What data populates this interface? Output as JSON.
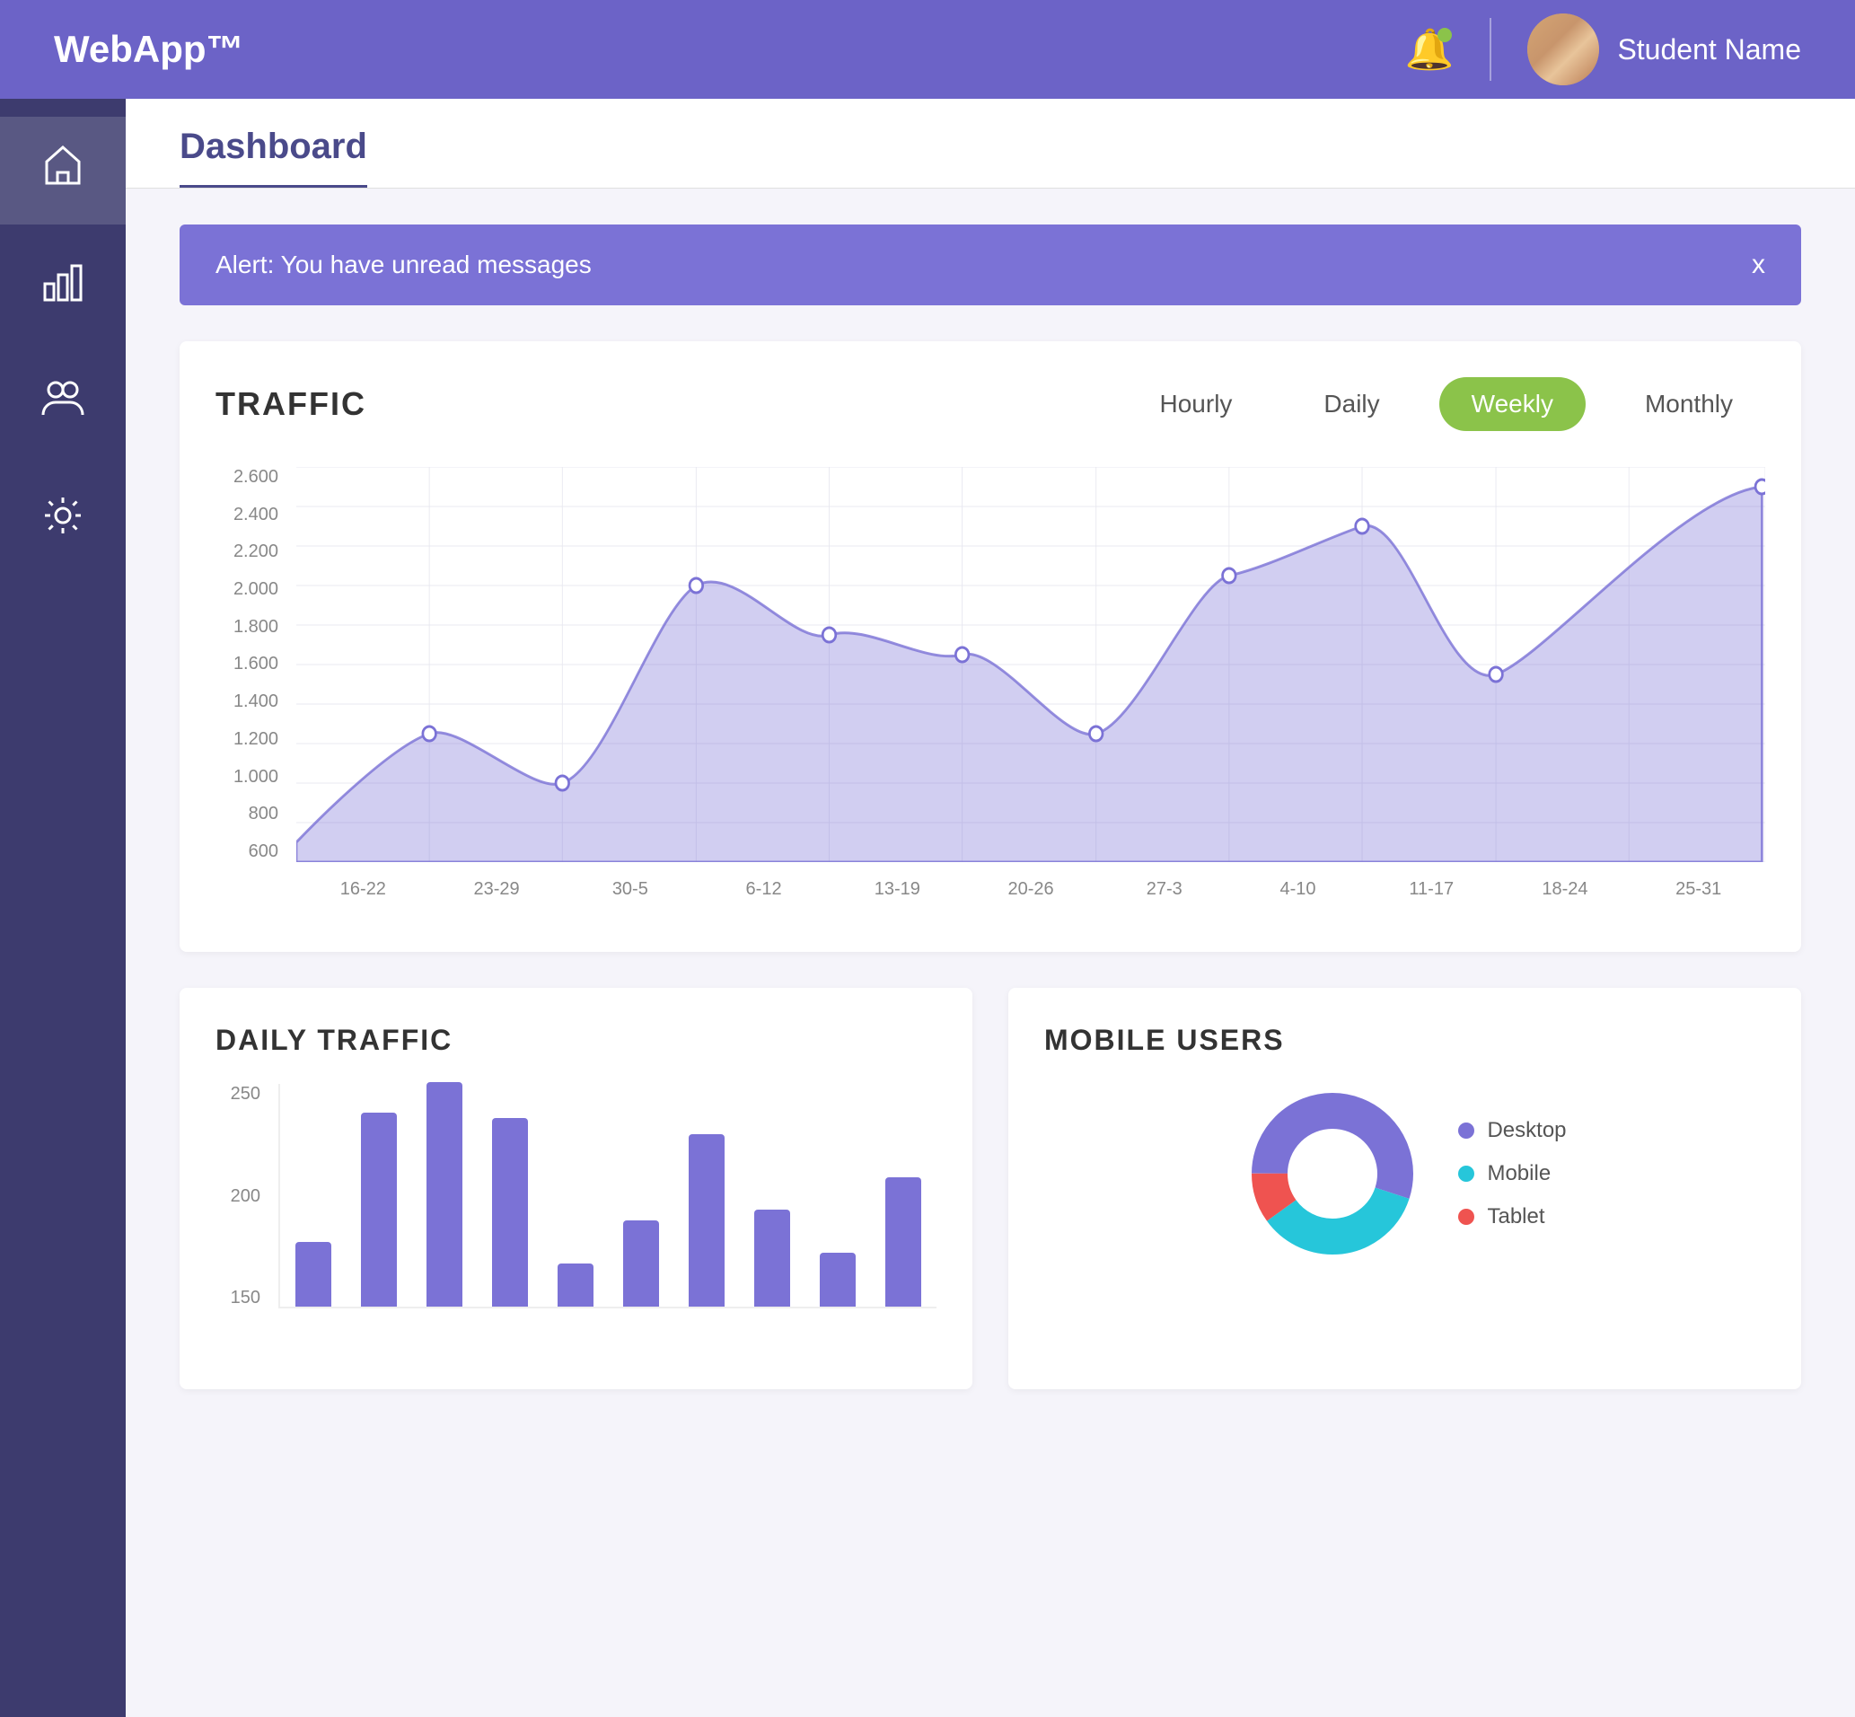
{
  "header": {
    "logo": "WebApp™",
    "user_name": "Student Name",
    "notification_aria": "notifications"
  },
  "sidebar": {
    "items": [
      {
        "label": "Home",
        "icon": "home"
      },
      {
        "label": "Analytics",
        "icon": "bar-chart"
      },
      {
        "label": "Users",
        "icon": "users"
      },
      {
        "label": "Settings",
        "icon": "settings"
      }
    ]
  },
  "page": {
    "title": "Dashboard"
  },
  "alert": {
    "message": "Alert: You have unread messages",
    "close": "x"
  },
  "traffic": {
    "title": "TRAFFIC",
    "filters": [
      "Hourly",
      "Daily",
      "Weekly",
      "Monthly"
    ],
    "active_filter": "Weekly",
    "y_labels": [
      "2.600",
      "2.400",
      "2.200",
      "2.000",
      "1.800",
      "1.600",
      "1.400",
      "1.200",
      "1.000",
      "800",
      "600"
    ],
    "x_labels": [
      "16-22",
      "23-29",
      "30-5",
      "6-12",
      "13-19",
      "20-26",
      "27-3",
      "4-10",
      "11-17",
      "18-24",
      "25-31"
    ],
    "data_points": [
      700,
      1250,
      1000,
      2000,
      1750,
      1650,
      1250,
      2050,
      2300,
      1550,
      2500
    ]
  },
  "daily_traffic": {
    "title": "DAILY TRAFFIC",
    "y_labels": [
      "250",
      "200",
      "150"
    ],
    "bars": [
      60,
      180,
      220,
      180,
      40,
      80,
      160,
      90,
      50,
      120
    ]
  },
  "mobile_users": {
    "title": "MOBILE USERS",
    "legend": [
      {
        "label": "Desktop",
        "color": "#7b72d6"
      },
      {
        "label": "Mobile",
        "color": "#26c6da"
      },
      {
        "label": "Tablet",
        "color": "#ef5350"
      }
    ]
  }
}
